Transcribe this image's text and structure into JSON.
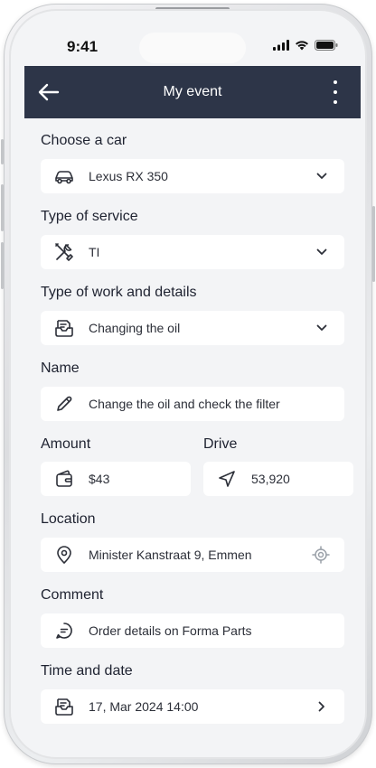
{
  "status_bar": {
    "time": "9:41"
  },
  "header": {
    "title": "My event"
  },
  "form": {
    "car": {
      "label": "Choose a car",
      "value": "Lexus RX 350"
    },
    "service": {
      "label": "Type of service",
      "value": "TI"
    },
    "work": {
      "label": "Type of work and details",
      "value": "Changing the oil"
    },
    "name": {
      "label": "Name",
      "value": "Change the oil and check the filter"
    },
    "amount": {
      "label": "Amount",
      "value": "$43"
    },
    "drive": {
      "label": "Drive",
      "value": "53,920"
    },
    "location": {
      "label": "Location",
      "value": "Minister Kanstraat 9, Emmen"
    },
    "comment": {
      "label": "Comment",
      "value": "Order details on Forma Parts"
    },
    "datetime": {
      "label": "Time and date",
      "value": "17, Mar 2024 14:00"
    }
  },
  "colors": {
    "header_bg": "#2d3548",
    "screen_bg": "#f3f4f6",
    "field_bg": "#ffffff"
  }
}
